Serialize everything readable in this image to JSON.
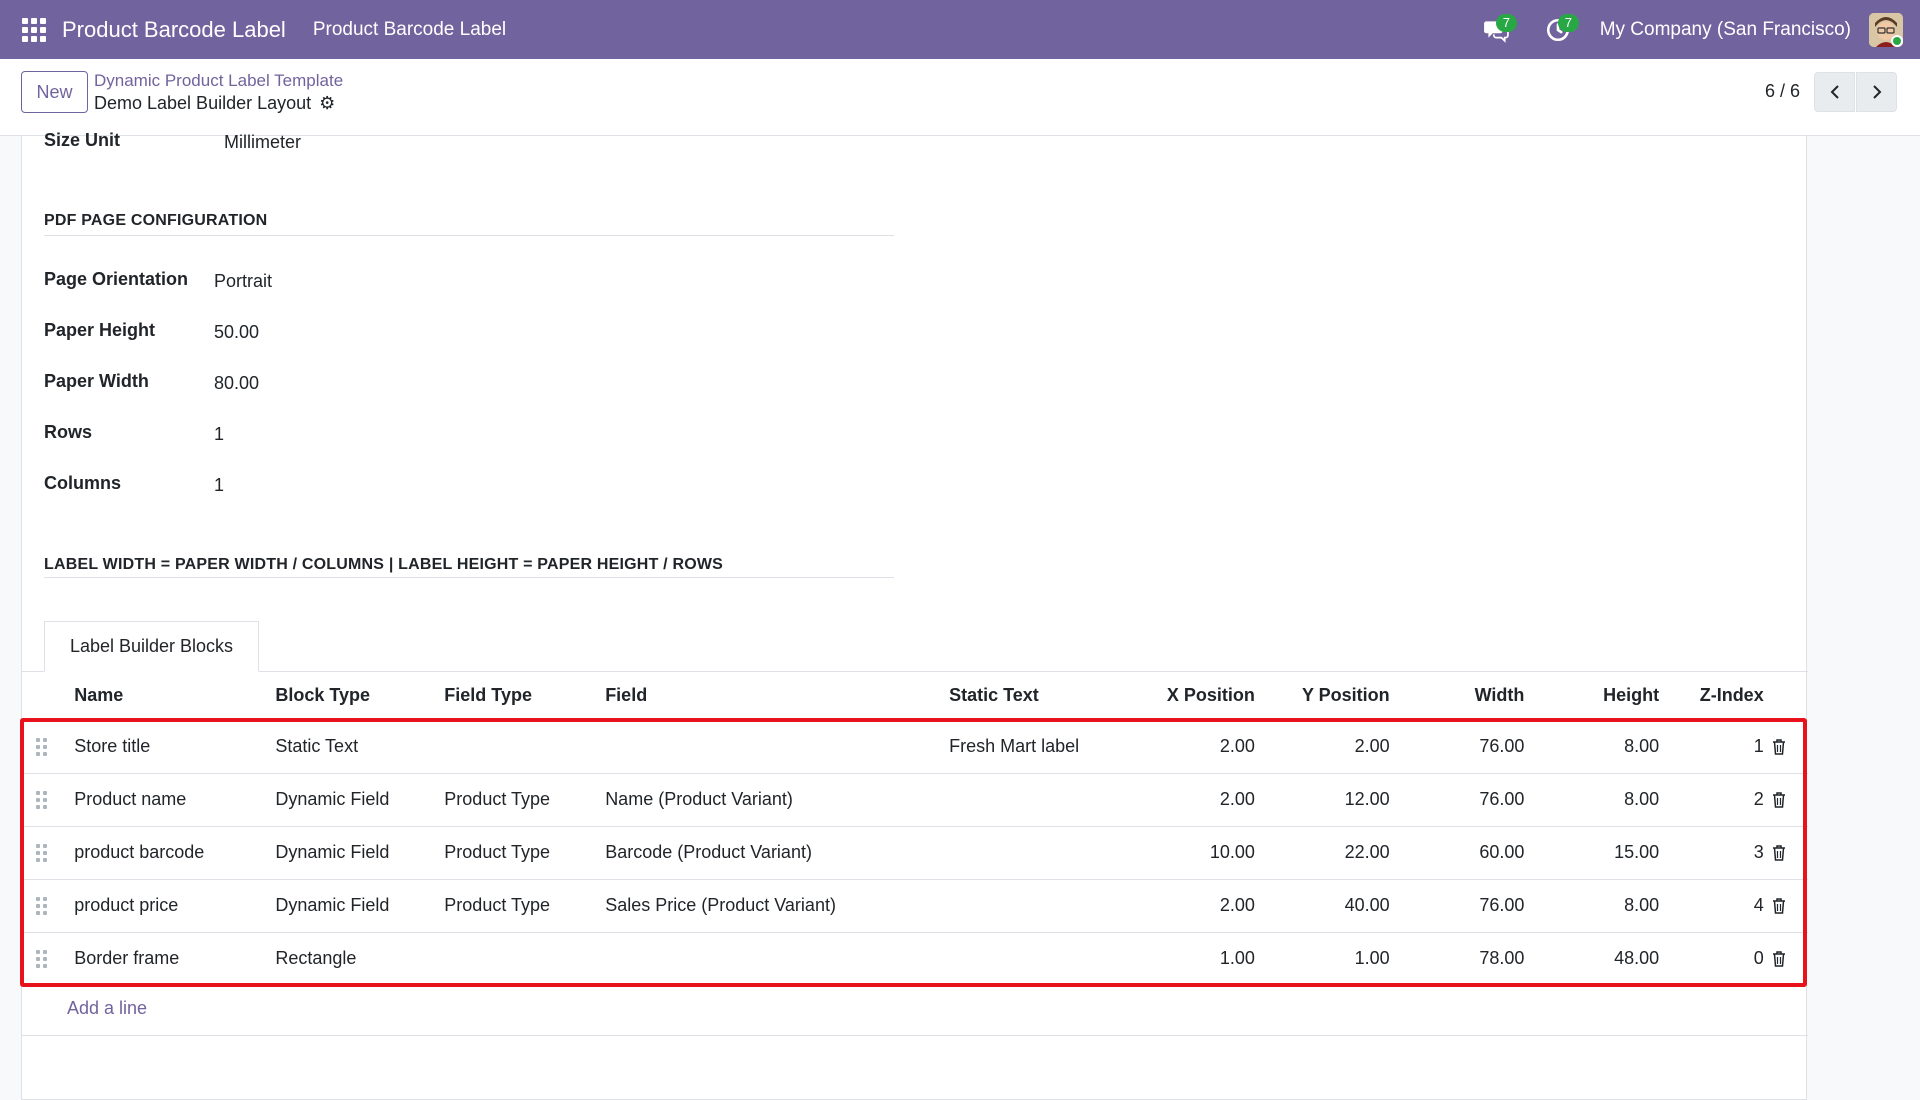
{
  "navbar": {
    "app_title": "Product Barcode Label",
    "menu_item": "Product Barcode Label",
    "messages_count": "7",
    "activities_count": "7",
    "company": "My Company (San Francisco)"
  },
  "control": {
    "new_label": "New",
    "breadcrumb_parent": "Dynamic Product Label Template",
    "breadcrumb_current": "Demo Label Builder Layout",
    "pager": "6 / 6"
  },
  "form": {
    "size_unit_label": "Size Unit",
    "size_unit_value": "Millimeter",
    "pdf_section_title": "PDF PAGE CONFIGURATION",
    "page_orientation_label": "Page Orientation",
    "page_orientation_value": "Portrait",
    "paper_height_label": "Paper Height",
    "paper_height_value": "50.00",
    "paper_width_label": "Paper Width",
    "paper_width_value": "80.00",
    "rows_label": "Rows",
    "rows_value": "1",
    "columns_label": "Columns",
    "columns_value": "1",
    "formula_title": "LABEL WIDTH = PAPER WIDTH / COLUMNS | LABEL HEIGHT = PAPER HEIGHT / ROWS"
  },
  "tabs": {
    "blocks_tab": "Label Builder Blocks"
  },
  "table": {
    "headers": {
      "name": "Name",
      "block_type": "Block Type",
      "field_type": "Field Type",
      "field": "Field",
      "static_text": "Static Text",
      "x_position": "X Position",
      "y_position": "Y Position",
      "width": "Width",
      "height": "Height",
      "z_index": "Z-Index"
    },
    "rows": [
      {
        "name": "Store title",
        "block_type": "Static Text",
        "field_type": "",
        "field": "",
        "static_text": "Fresh Mart label",
        "x": "2.00",
        "y": "2.00",
        "width": "76.00",
        "height": "8.00",
        "z": "1"
      },
      {
        "name": "Product name",
        "block_type": "Dynamic Field",
        "field_type": "Product Type",
        "field": "Name (Product Variant)",
        "static_text": "",
        "x": "2.00",
        "y": "12.00",
        "width": "76.00",
        "height": "8.00",
        "z": "2"
      },
      {
        "name": "product barcode",
        "block_type": "Dynamic Field",
        "field_type": "Product Type",
        "field": "Barcode (Product Variant)",
        "static_text": "",
        "x": "10.00",
        "y": "22.00",
        "width": "60.00",
        "height": "15.00",
        "z": "3"
      },
      {
        "name": "product price",
        "block_type": "Dynamic Field",
        "field_type": "Product Type",
        "field": "Sales Price (Product Variant)",
        "static_text": "",
        "x": "2.00",
        "y": "40.00",
        "width": "76.00",
        "height": "8.00",
        "z": "4"
      },
      {
        "name": "Border frame",
        "block_type": "Rectangle",
        "field_type": "",
        "field": "",
        "static_text": "",
        "x": "1.00",
        "y": "1.00",
        "width": "78.00",
        "height": "48.00",
        "z": "0"
      }
    ],
    "add_line": "Add a line"
  },
  "colors": {
    "navbar": "#71639e",
    "accent": "#71639e",
    "badge": "#28a745",
    "highlight": "#e8121c"
  }
}
